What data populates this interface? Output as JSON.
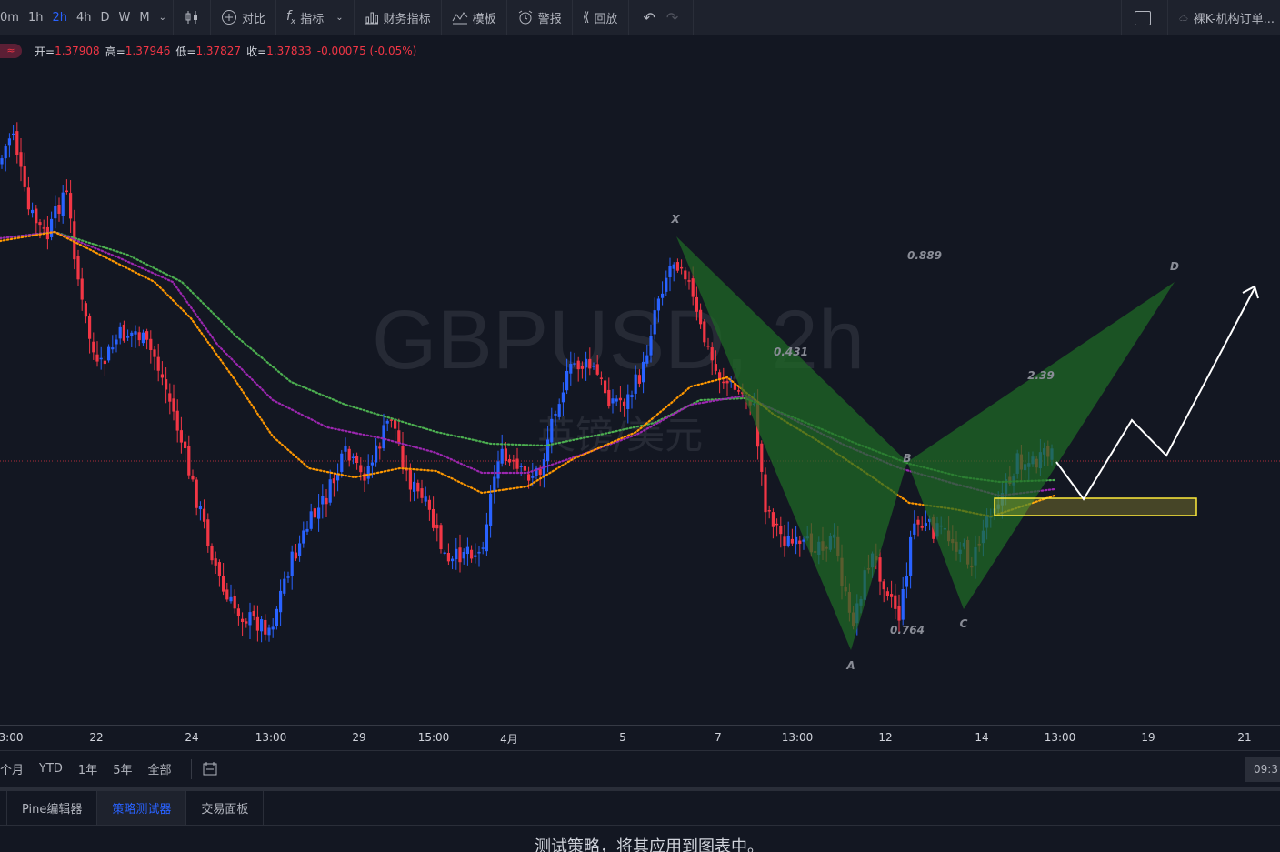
{
  "toolbar": {
    "timeframes": [
      "0m",
      "1h",
      "2h",
      "4h",
      "D",
      "W",
      "M"
    ],
    "active_timeframe": "2h",
    "buttons": {
      "compare": "对比",
      "indicators": "指标",
      "financials": "财务指标",
      "templates": "模板",
      "alerts": "警报",
      "replay": "回放"
    },
    "cloud_layout": "裸K-机构订单..."
  },
  "legend": {
    "open_label": "开=",
    "open": "1.37908",
    "high_label": "高=",
    "high": "1.37946",
    "low_label": "低=",
    "low": "1.37827",
    "close_label": "收=",
    "close": "1.37833",
    "change": "-0.00075 (-0.05%)"
  },
  "watermark": {
    "symbol": "GBPUSD, 2h",
    "name": "英镑/美元"
  },
  "pattern_labels": {
    "X": "X",
    "A": "A",
    "B": "B",
    "C": "C",
    "D": "D",
    "r1": "0.431",
    "r2": "0.889",
    "r3": "0.764",
    "r4": "2.39"
  },
  "colors": {
    "up": "#2962ff",
    "down": "#f23645",
    "pattern": "#1e6b26",
    "ma_orange": "#ff9800",
    "ma_purple": "#9c27b0",
    "ma_green": "#4caf50",
    "zone": "#ffeb3b"
  },
  "time_axis": [
    "3:00",
    "22",
    "24",
    "13:00",
    "29",
    "15:00",
    "4月",
    "5",
    "7",
    "13:00",
    "12",
    "14",
    "13:00",
    "19",
    "21"
  ],
  "ranges": [
    "个月",
    "YTD",
    "1年",
    "5年",
    "全部"
  ],
  "current_time": "09:3",
  "panel_tabs": [
    "Pine编辑器",
    "策略测试器",
    "交易面板"
  ],
  "active_panel_tab": "策略测试器",
  "panel_message": "测试策略，将其应用到图表中。"
}
